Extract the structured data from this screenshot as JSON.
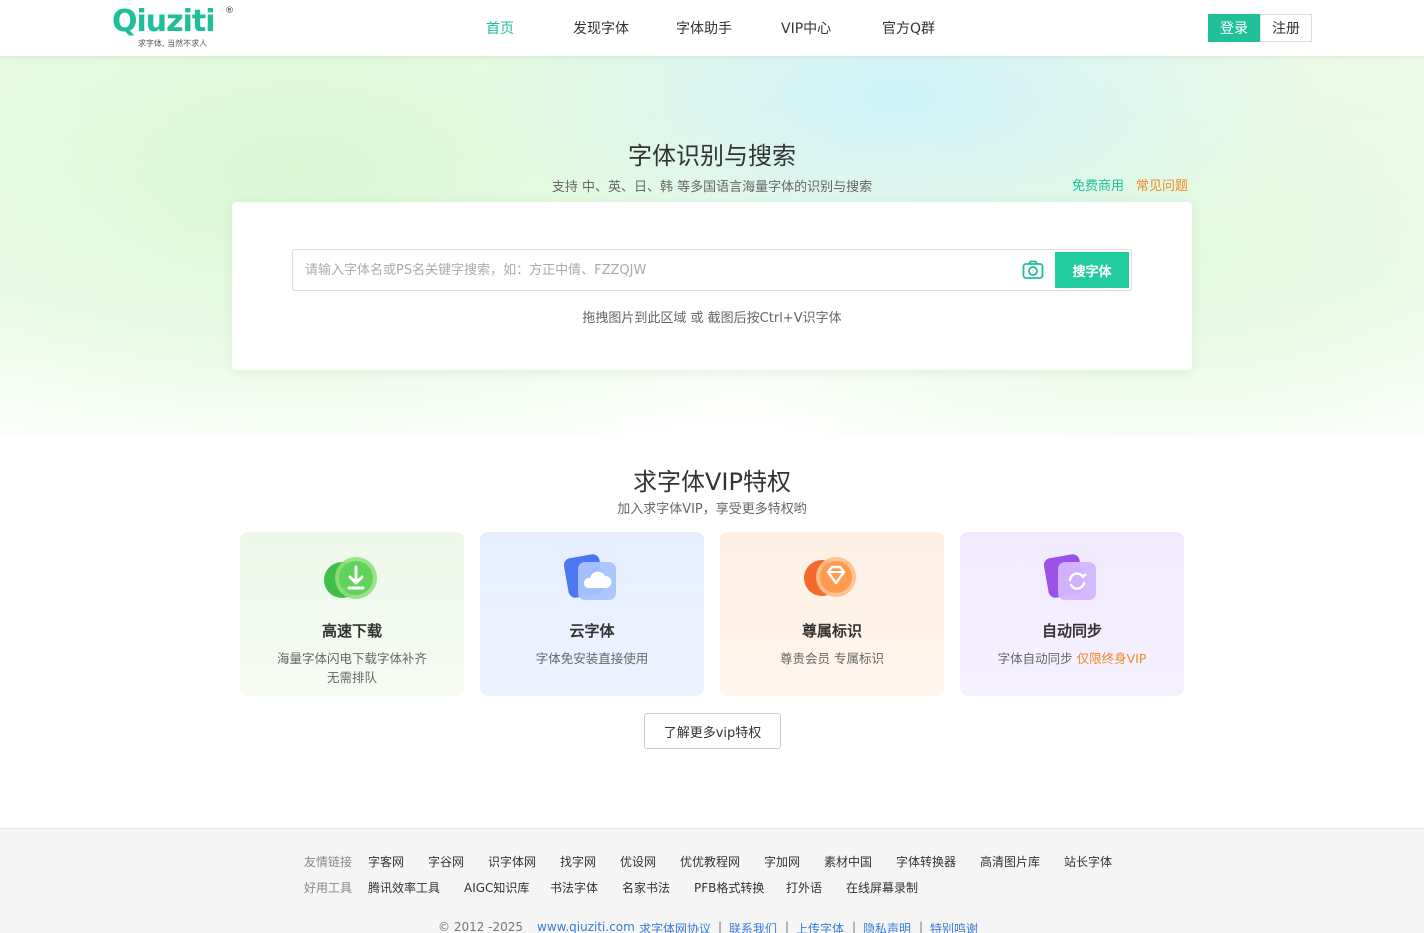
{
  "header": {
    "logo_text": "Qiuziti",
    "logo_registered": "®",
    "logo_slogan": "求字体, 当然不求人",
    "nav": [
      {
        "label": "首页",
        "active": true
      },
      {
        "label": "发现字体",
        "active": false
      },
      {
        "label": "字体助手",
        "active": false
      },
      {
        "label": "VIP中心",
        "active": false
      },
      {
        "label": "官方Q群",
        "active": false
      }
    ],
    "login_label": "登录",
    "register_label": "注册"
  },
  "hero": {
    "title": "字体识别与搜索",
    "subtitle": "支持 中、英、日、韩 等多国语言海量字体的识别与搜索",
    "link_free": "免费商用",
    "link_faq": "常见问题",
    "search_placeholder": "请输入字体名或PS名关键字搜索，如：方正中倩、FZZQJW",
    "search_button": "搜字体",
    "camera_icon": "camera-icon",
    "hint": "拖拽图片到此区域 或 截图后按Ctrl+V识字体"
  },
  "vip": {
    "title": "求字体VIP特权",
    "subtitle": "加入求字体VIP，享受更多特权哟",
    "cards": [
      {
        "title": "高速下载",
        "desc_line1": "海量字体闪电下载字体补齐",
        "desc_line2": "无需排队",
        "icon": "download-icon"
      },
      {
        "title": "云字体",
        "desc": "字体免安装直接使用",
        "icon": "cloud-icon"
      },
      {
        "title": "尊属标识",
        "desc": "尊贵会员 专属标识",
        "icon": "diamond-badge-icon"
      },
      {
        "title": "自动同步",
        "desc": "字体自动同步",
        "highlight": "仅限终身VIP",
        "icon": "sync-icon"
      }
    ],
    "more_button": "了解更多vip特权"
  },
  "footer": {
    "friend_links_label": "友情链接",
    "friend_links": [
      "字客网",
      "字谷网",
      "识字体网",
      "找字网",
      "优设网",
      "优优教程网",
      "字加网",
      "素材中国",
      "字体转换器",
      "高清图片库",
      "站长字体"
    ],
    "tools_label": "好用工具",
    "tools": [
      "腾讯效率工具",
      "AIGC知识库",
      "书法字体",
      "名家书法",
      "PFB格式转换",
      "打外语",
      "在线屏幕录制"
    ],
    "copyright": "©  2012 -2025",
    "site": "www.qiuziti.com",
    "bottom_links": [
      "求字体网协议",
      "联系我们",
      "上传字体",
      "隐私声明",
      "特别鸣谢"
    ],
    "separator": "|"
  },
  "colors": {
    "accent": "#1fbf9a",
    "orange": "#f08a24",
    "link_blue": "#3a7bd5"
  }
}
